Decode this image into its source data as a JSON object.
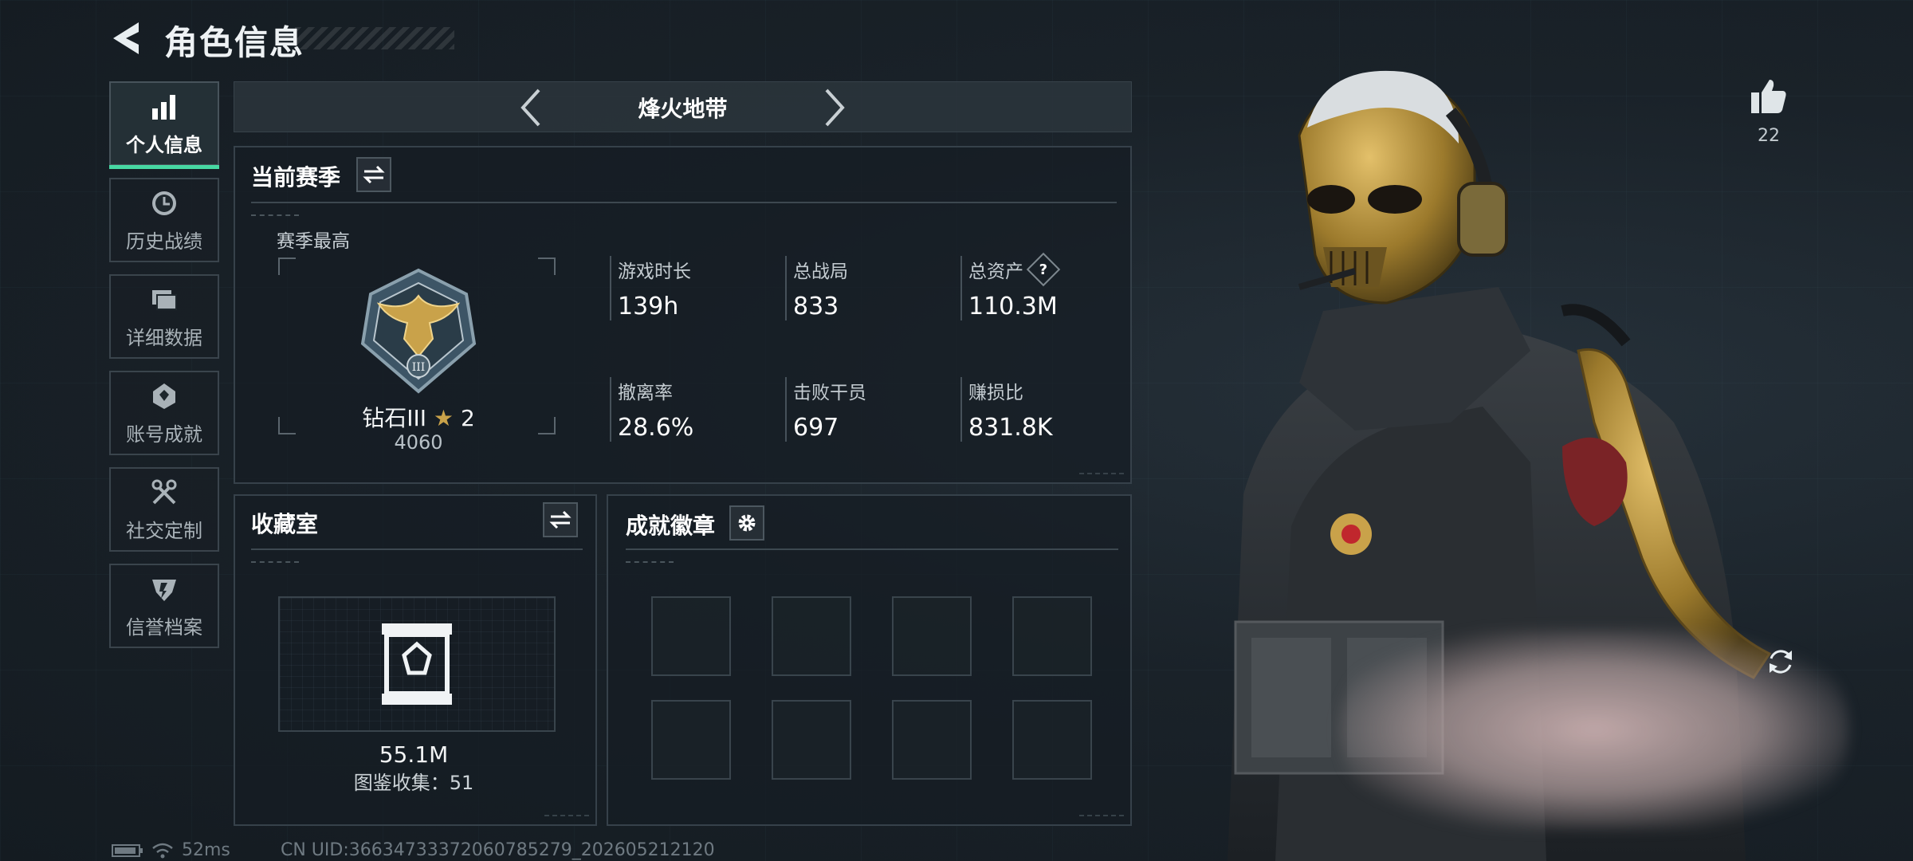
{
  "header": {
    "title": "角色信息"
  },
  "sidebar": {
    "items": [
      {
        "label": "个人信息",
        "icon": "bar-chart-icon",
        "active": true
      },
      {
        "label": "历史战绩",
        "icon": "clock-icon",
        "active": false
      },
      {
        "label": "详细数据",
        "icon": "folders-icon",
        "active": false
      },
      {
        "label": "账号成就",
        "icon": "achievement-icon",
        "active": false
      },
      {
        "label": "社交定制",
        "icon": "tools-icon",
        "active": false
      },
      {
        "label": "信誉档案",
        "icon": "shield-icon",
        "active": false
      }
    ]
  },
  "mode": {
    "name": "烽火地带"
  },
  "season": {
    "title": "当前赛季",
    "best_label": "赛季最高",
    "rank_name": "钻石III",
    "rank_stars": "2",
    "rank_points": "4060",
    "stats": [
      {
        "label": "游戏时长",
        "value": "139h"
      },
      {
        "label": "总战局",
        "value": "833"
      },
      {
        "label": "总资产",
        "value": "110.3M",
        "help": "?"
      },
      {
        "label": "撤离率",
        "value": "28.6%"
      },
      {
        "label": "击败干员",
        "value": "697"
      },
      {
        "label": "赚损比",
        "value": "831.8K"
      }
    ]
  },
  "collection": {
    "title": "收藏室",
    "value": "55.1M",
    "count_text": "图鉴收集：51"
  },
  "badges": {
    "title": "成就徽章",
    "slot_count": 8
  },
  "like": {
    "count": "22"
  },
  "status": {
    "ping": "52ms",
    "uid": "CN UID:3663473337206078527​9_202605212120"
  },
  "colors": {
    "accent": "#47d8a3",
    "panel_border": "#36414a",
    "gold": "#c9a24a"
  }
}
